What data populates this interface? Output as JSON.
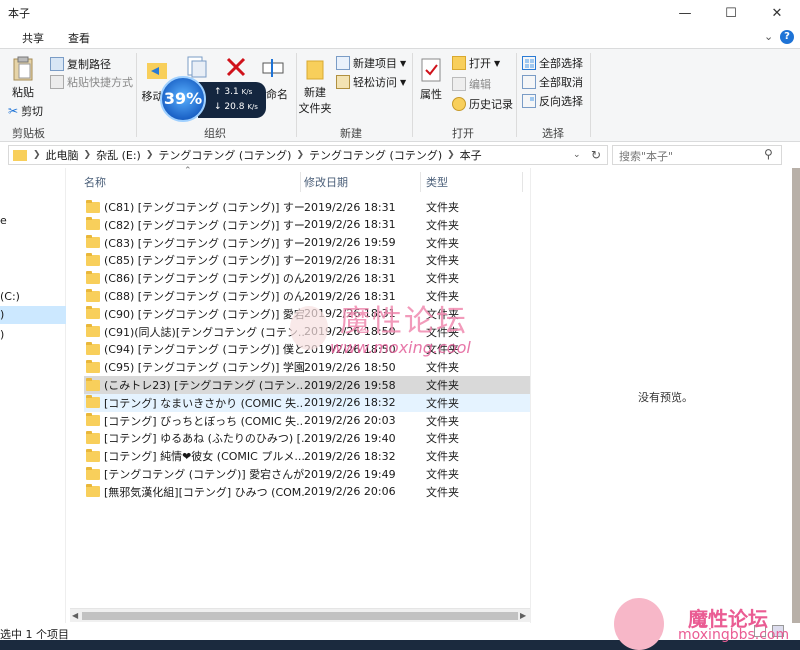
{
  "window": {
    "title": "本子"
  },
  "ribbon_tabs": [
    "共享",
    "查看"
  ],
  "ribbon": {
    "clipboard": {
      "paste": "粘贴",
      "copy_path": "复制路径",
      "paste_shortcut": "粘贴快捷方式",
      "cut": "剪切",
      "group": "剪贴板"
    },
    "organize": {
      "move_to": "移动到",
      "rename": "命名",
      "group": "组织"
    },
    "new": {
      "new_item": "新建项目",
      "easy_access": "轻松访问",
      "new_folder_l1": "新建",
      "new_folder_l2": "文件夹",
      "group": "新建"
    },
    "open": {
      "properties": "属性",
      "open": "打开",
      "edit": "编辑",
      "history": "历史记录",
      "group": "打开"
    },
    "select": {
      "select_all": "全部选择",
      "select_none": "全部取消",
      "invert": "反向选择",
      "group": "选择"
    }
  },
  "net_widget": {
    "percent": "39%",
    "up": "3.1",
    "down": "20.8",
    "unit": "K/s"
  },
  "breadcrumb": [
    "此电脑",
    "杂乱 (E:)",
    "テングコテング (コテング)",
    "テングコテング (コテング)",
    "本子"
  ],
  "search": {
    "placeholder": "搜索\"本子\""
  },
  "left_nav": [
    "e",
    "(C:)",
    ")",
    ")"
  ],
  "columns": {
    "name": "名称",
    "date": "修改日期",
    "type": "类型"
  },
  "files": [
    {
      "name": "(C81) [テングコテング (コテング)] すー...",
      "date": "2019/2/26 18:31",
      "type": "文件夹"
    },
    {
      "name": "(C82) [テングコテング (コテング)] すー...",
      "date": "2019/2/26 18:31",
      "type": "文件夹"
    },
    {
      "name": "(C83) [テングコテング (コテング)] すー...",
      "date": "2019/2/26 19:59",
      "type": "文件夹"
    },
    {
      "name": "(C85) [テングコテング (コテング)] すー...",
      "date": "2019/2/26 18:31",
      "type": "文件夹"
    },
    {
      "name": "(C86) [テングコテング (コテング)] のん...",
      "date": "2019/2/26 18:31",
      "type": "文件夹"
    },
    {
      "name": "(C88) [テングコテング (コテング)] のん...",
      "date": "2019/2/26 18:31",
      "type": "文件夹"
    },
    {
      "name": "(C90) [テングコテング (コテング)] 愛宕...",
      "date": "2019/2/26 18:31",
      "type": "文件夹"
    },
    {
      "name": "(C91)(同人誌)[テングコテング (コテン...",
      "date": "2019/2/26 18:50",
      "type": "文件夹"
    },
    {
      "name": "(C94) [テングコテング (コテング)] 僕と...",
      "date": "2019/2/26 18:50",
      "type": "文件夹"
    },
    {
      "name": "(C95) [テングコテング (コテング)] 学園...",
      "date": "2019/2/26 18:50",
      "type": "文件夹"
    },
    {
      "name": "(こみトレ23) [テングコテング (コテン...",
      "date": "2019/2/26 19:58",
      "type": "文件夹"
    },
    {
      "name": "[コテング] なまいきさかり (COMIC 失...",
      "date": "2019/2/26 18:32",
      "type": "文件夹"
    },
    {
      "name": "[コテング] びっちとぼっち (COMIC 失...",
      "date": "2019/2/26 20:03",
      "type": "文件夹"
    },
    {
      "name": "[コテング] ゆるあね (ふたりのひみつ) [...",
      "date": "2019/2/26 19:40",
      "type": "文件夹"
    },
    {
      "name": "[コテング] 純情❤彼女 (COMIC プルメ...",
      "date": "2019/2/26 18:32",
      "type": "文件夹"
    },
    {
      "name": "[テングコテング (コテング)] 愛宕さんが...",
      "date": "2019/2/26 19:49",
      "type": "文件夹"
    },
    {
      "name": "[無邪気漢化組][コテング] ひみつ (COM...",
      "date": "2019/2/26 20:06",
      "type": "文件夹"
    }
  ],
  "preview": {
    "empty_text": "没有预览。"
  },
  "status": {
    "text": "选中 1 个项目"
  },
  "watermarks": {
    "main": "魔性论坛",
    "main_url": "www.moxing.cool",
    "corner": "魔性论坛",
    "corner_url": "moxingbbs.com"
  }
}
